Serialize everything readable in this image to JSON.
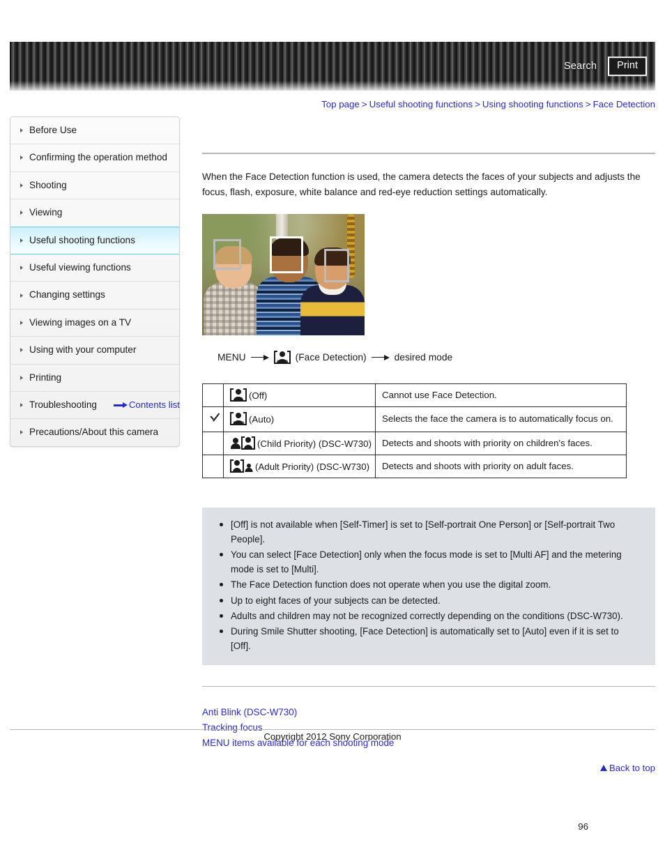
{
  "header": {
    "search_label": "Search",
    "print_label": "Print"
  },
  "breadcrumb": {
    "separator": ">",
    "items": [
      {
        "label": "Top page"
      },
      {
        "label": "Useful shooting functions"
      },
      {
        "label": "Using shooting functions"
      },
      {
        "label": "Face Detection"
      }
    ]
  },
  "sidebar": {
    "items": [
      {
        "label": "Before Use",
        "active": false
      },
      {
        "label": "Confirming the operation method",
        "active": false
      },
      {
        "label": "Shooting",
        "active": false
      },
      {
        "label": "Viewing",
        "active": false
      },
      {
        "label": "Useful shooting functions",
        "active": true
      },
      {
        "label": "Useful viewing functions",
        "active": false
      },
      {
        "label": "Changing settings",
        "active": false
      },
      {
        "label": "Viewing images on a TV",
        "active": false
      },
      {
        "label": "Using with your computer",
        "active": false
      },
      {
        "label": "Printing",
        "active": false
      },
      {
        "label": "Troubleshooting",
        "active": false
      },
      {
        "label": "Precautions/About this camera",
        "active": false
      }
    ],
    "contents_list_label": "Contents list"
  },
  "main": {
    "intro": "When the Face Detection function is used, the camera detects the faces of your subjects and adjusts the focus, flash, exposure, white balance and red-eye reduction settings automatically.",
    "menu_path": {
      "start": "MENU",
      "icon_label": "AUTO",
      "middle": "(Face Detection)",
      "end": "desired mode"
    },
    "table": {
      "rows": [
        {
          "checked": false,
          "icon_type": "bracket",
          "icon_label": "OFF",
          "mode": "(Off)",
          "description": "Cannot use Face Detection."
        },
        {
          "checked": true,
          "icon_type": "bracket",
          "icon_label": "AUTO",
          "mode": "(Auto)",
          "description": "Selects the face the camera is to automatically focus on."
        },
        {
          "checked": false,
          "icon_type": "person-left",
          "icon_label": "",
          "mode": "(Child Priority) (DSC-W730)",
          "description": "Detects and shoots with priority on children's faces."
        },
        {
          "checked": false,
          "icon_type": "person-right",
          "icon_label": "",
          "mode": "(Adult Priority) (DSC-W730)",
          "description": "Detects and shoots with priority on adult faces."
        }
      ]
    },
    "notes": [
      "[Off] is not available when [Self-Timer] is set to [Self-portrait One Person] or [Self-portrait Two People].",
      "You can select [Face Detection] only when the focus mode is set to [Multi AF] and the metering mode is set to [Multi].",
      "The Face Detection function does not operate when you use the digital zoom.",
      "Up to eight faces of your subjects can be detected.",
      "Adults and children may not be recognized correctly depending on the conditions (DSC-W730).",
      "During Smile Shutter shooting, [Face Detection] is automatically set to [Auto] even if it is set to [Off]."
    ],
    "related_links": [
      {
        "label": "Anti Blink (DSC-W730)"
      },
      {
        "label": "Tracking focus"
      },
      {
        "label": "MENU items available for each shooting mode"
      }
    ],
    "back_to_top_label": "Back to top"
  },
  "footer": {
    "copyright": "Copyright 2012 Sony Corporation",
    "page_number": "96"
  },
  "colors": {
    "link": "#2929c4",
    "active_nav": "#c9effa",
    "notes_bg": "#dde1e6"
  }
}
